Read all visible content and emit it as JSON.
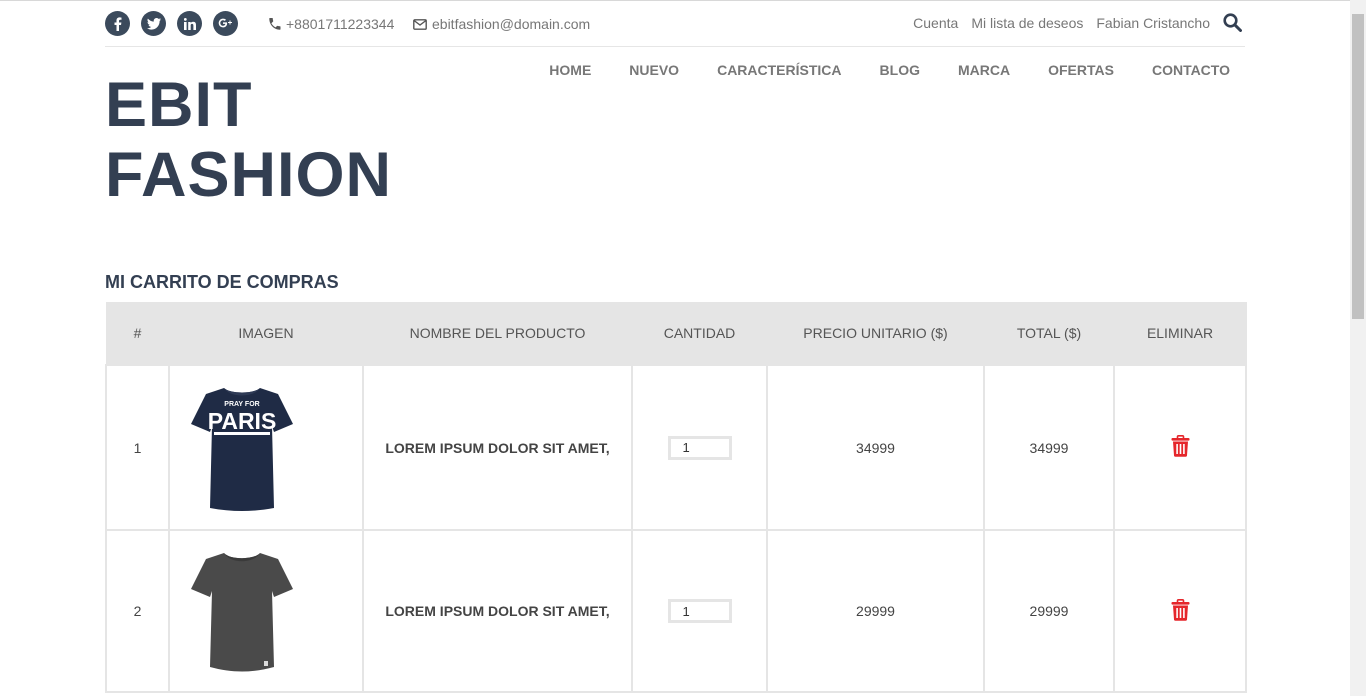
{
  "social": [
    {
      "name": "facebook",
      "glyph": "f"
    },
    {
      "name": "twitter",
      "glyph": "t"
    },
    {
      "name": "linkedin",
      "glyph": "in"
    },
    {
      "name": "google-plus",
      "glyph": "g+"
    }
  ],
  "contact": {
    "phone": "+8801711223344",
    "email": "ebitfashion@domain.com"
  },
  "toplinks": {
    "account": "Cuenta",
    "wishlist": "Mi lista de deseos",
    "user": "Fabian Cristancho"
  },
  "brand": {
    "line1": "EBIT",
    "line2": "FASHION"
  },
  "nav": [
    "HOME",
    "NUEVO",
    "CARACTERÍSTICA",
    "BLOG",
    "MARCA",
    "OFERTAS",
    "CONTACTO"
  ],
  "cart": {
    "title": "MI CARRITO DE COMPRAS",
    "headers": [
      "#",
      "IMAGEN",
      "NOMBRE DEL PRODUCTO",
      "CANTIDAD",
      "PRECIO UNITARIO ($)",
      "TOTAL ($)",
      "ELIMINAR"
    ],
    "rows": [
      {
        "index": "1",
        "image": "navy-paris-tshirt",
        "print_top": "PRAY FOR",
        "print_main": "PARIS",
        "name": "LOREM IPSUM DOLOR SIT AMET,",
        "qty": "1",
        "unit_price": "34999",
        "total": "34999"
      },
      {
        "index": "2",
        "image": "gray-tshirt",
        "name": "LOREM IPSUM DOLOR SIT AMET,",
        "qty": "1",
        "unit_price": "29999",
        "total": "29999"
      }
    ]
  },
  "colors": {
    "brand": "#333f52",
    "social_bg": "#3b4a5c",
    "delete": "#e5262b",
    "header_bg": "#e5e5e5"
  }
}
